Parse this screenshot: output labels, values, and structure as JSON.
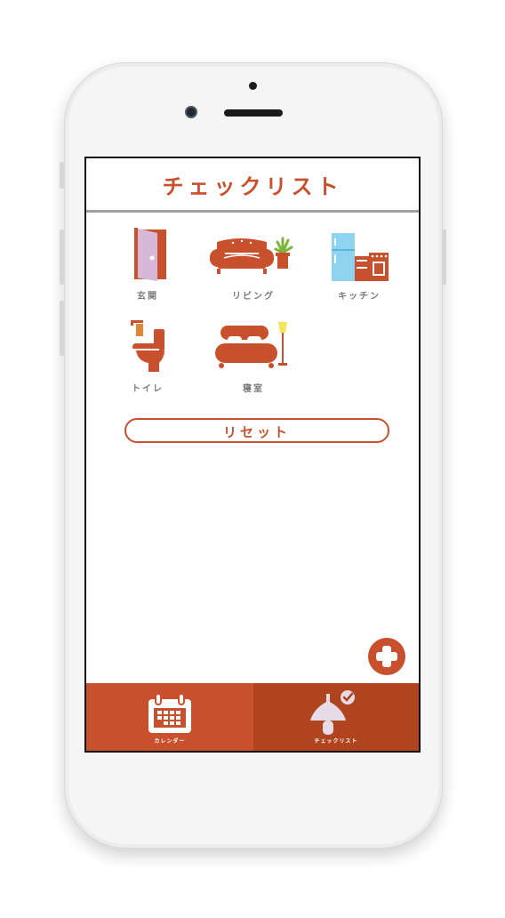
{
  "header": {
    "title": "チェックリスト"
  },
  "rooms": [
    {
      "label": "玄関",
      "icon": "door-icon"
    },
    {
      "label": "リビング",
      "icon": "sofa-icon"
    },
    {
      "label": "キッチン",
      "icon": "kitchen-icon"
    },
    {
      "label": "トイレ",
      "icon": "toilet-icon"
    },
    {
      "label": "寝室",
      "icon": "bed-icon"
    }
  ],
  "reset": {
    "label": "リセット"
  },
  "fab": {
    "icon": "plus-icon"
  },
  "tabs": [
    {
      "label": "カレンダー",
      "icon": "calendar-icon"
    },
    {
      "label": "チェックリスト",
      "icon": "checklist-icon"
    }
  ],
  "colors": {
    "accent": "#c9502c",
    "accent_dark": "#b0441f",
    "divider": "#a0a0a0",
    "label_gray": "#7a7a7a"
  }
}
